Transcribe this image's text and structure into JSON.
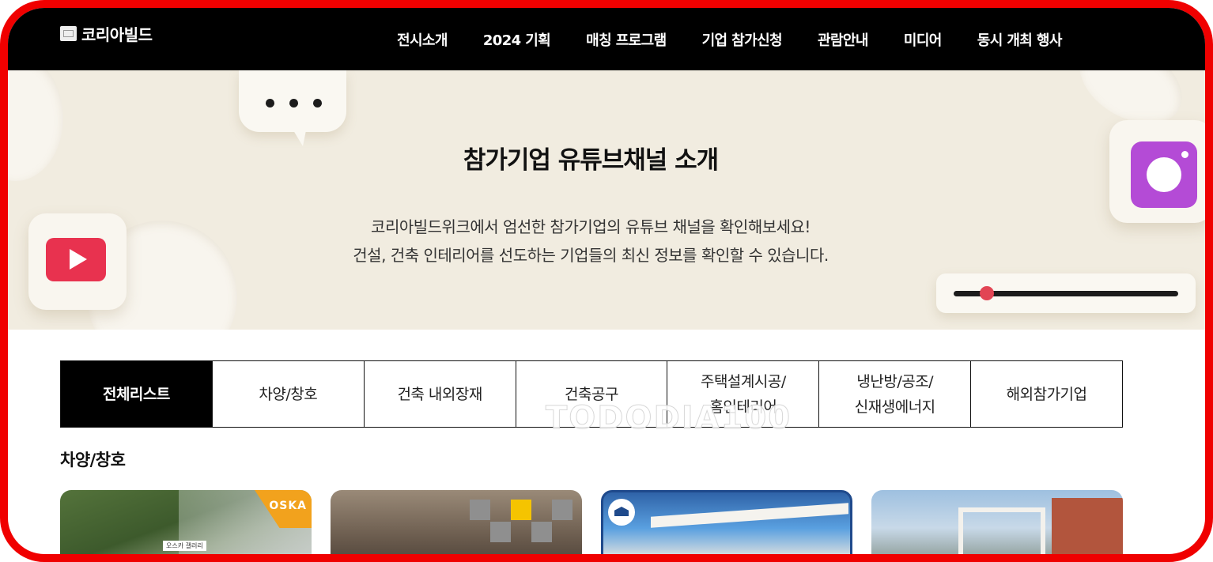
{
  "header": {
    "logo_text": "코리아빌드",
    "nav": [
      "전시소개",
      "2024 기획",
      "매칭 프로그램",
      "기업 참가신청",
      "관람안내",
      "미디어",
      "동시 개최 행사"
    ]
  },
  "hero": {
    "title": "참가기업 유튜브채널 소개",
    "desc_line1": "코리아빌드위크에서 엄선한 참가기업의 유튜브 채널을 확인해보세요!",
    "desc_line2": "건설, 건축 인테리어를 선도하는 기업들의 최신 정보를 확인할 수 있습니다."
  },
  "tabs": [
    {
      "line1": "전체리스트",
      "line2": ""
    },
    {
      "line1": "차양/창호",
      "line2": ""
    },
    {
      "line1": "건축 내외장재",
      "line2": ""
    },
    {
      "line1": "건축공구",
      "line2": ""
    },
    {
      "line1": "주택설계시공/",
      "line2": "홈인테리어"
    },
    {
      "line1": "냉난방/공조/",
      "line2": "신재생에너지"
    },
    {
      "line1": "해외참가기업",
      "line2": ""
    }
  ],
  "active_tab_index": 0,
  "watermark": "TODODIA100",
  "section_title": "차양/창호",
  "thumbnails": {
    "t1_brand": "OSKA",
    "t1_label": "오스카 갤러리"
  },
  "colors": {
    "frame_border": "#f00000",
    "hero_bg": "#f1ece0",
    "youtube_red": "#e8324f",
    "instagram_purple": "#b44bd6",
    "active_tab_bg": "#000000"
  },
  "icons": [
    "youtube-play-icon",
    "instagram-icon",
    "chat-bubble-icon",
    "slider-icon"
  ]
}
